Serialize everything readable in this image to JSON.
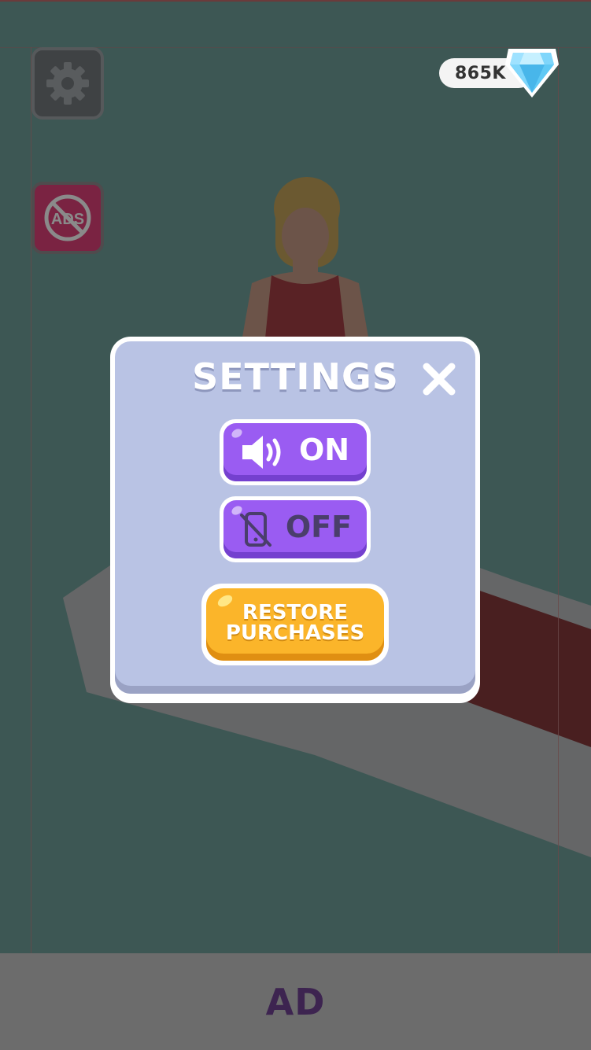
{
  "hud": {
    "gem_count": "865K",
    "settings_icon": "gear-icon",
    "no_ads_icon": "no-ads-icon",
    "gem_icon": "diamond-icon"
  },
  "settings_modal": {
    "title": "SETTINGS",
    "close_icon": "close-icon",
    "sound_toggle": {
      "icon": "speaker-icon",
      "label": "ON"
    },
    "vibration_toggle": {
      "icon": "no-vibration-icon",
      "label": "OFF"
    },
    "restore_button": {
      "line1": "RESTORE",
      "line2": "PURCHASES"
    }
  },
  "ad_banner": {
    "label": "AD"
  },
  "colors": {
    "modal_panel": "#b9c3e4",
    "toggle_purple": "#9a5cf2",
    "restore_orange": "#fbb52a",
    "gem_blue": "#6fd3ff"
  }
}
